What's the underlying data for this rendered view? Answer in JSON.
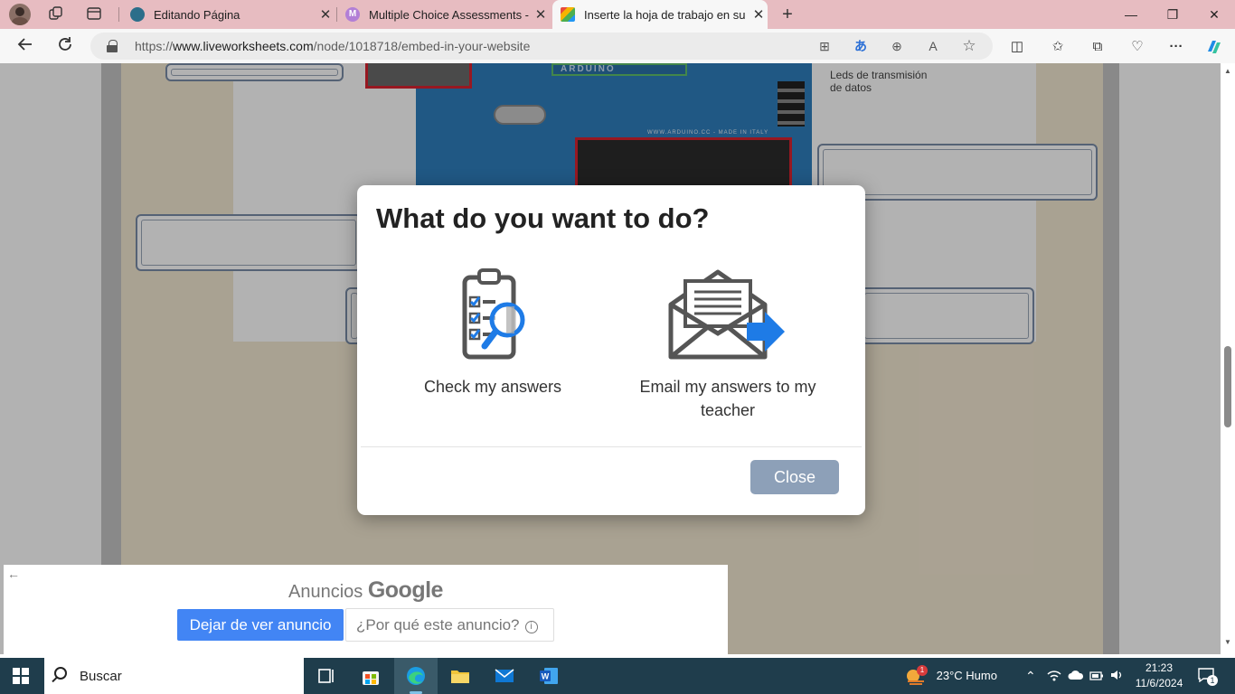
{
  "browser": {
    "tabs": [
      {
        "title": "Editando Página",
        "active": false
      },
      {
        "title": "Multiple Choice Assessments - M",
        "active": false
      },
      {
        "title": "Inserte la hoja de trabajo en su p",
        "active": true
      }
    ],
    "new_tab_symbol": "+",
    "window_controls": {
      "minimize": "—",
      "restore": "❐",
      "close": "✕"
    },
    "url_prefix": "https://",
    "url_host": "www.liveworksheets.com",
    "url_path": "/node/1018718/embed-in-your-website"
  },
  "worksheet": {
    "board_text": "ARDUINO",
    "board_small_text": "WWW.ARDUINO.CC - MADE IN ITALY",
    "leds_label_line1": "Leds de transmisión",
    "leds_label_line2": "de datos"
  },
  "modal": {
    "title": "What do you want to do?",
    "options": [
      {
        "label": "Check my answers",
        "icon": "clipboard-magnifier-icon"
      },
      {
        "label_line1": "Email my answers to my",
        "label_line2": "teacher",
        "icon": "envelope-send-icon"
      }
    ],
    "close_label": "Close",
    "colors": {
      "close_button": "#8da0b8",
      "accent_blue": "#1e7be6"
    }
  },
  "ad": {
    "title_prefix": "Anuncios",
    "title_brand": "Google",
    "stop_label": "Dejar de ver anuncio",
    "why_label": "¿Por qué este anuncio?"
  },
  "taskbar": {
    "search_placeholder": "Buscar",
    "weather": "23°C  Humo",
    "time": "21:23",
    "date": "11/6/2024",
    "notifications_count": "1",
    "weather_badge": "1"
  }
}
